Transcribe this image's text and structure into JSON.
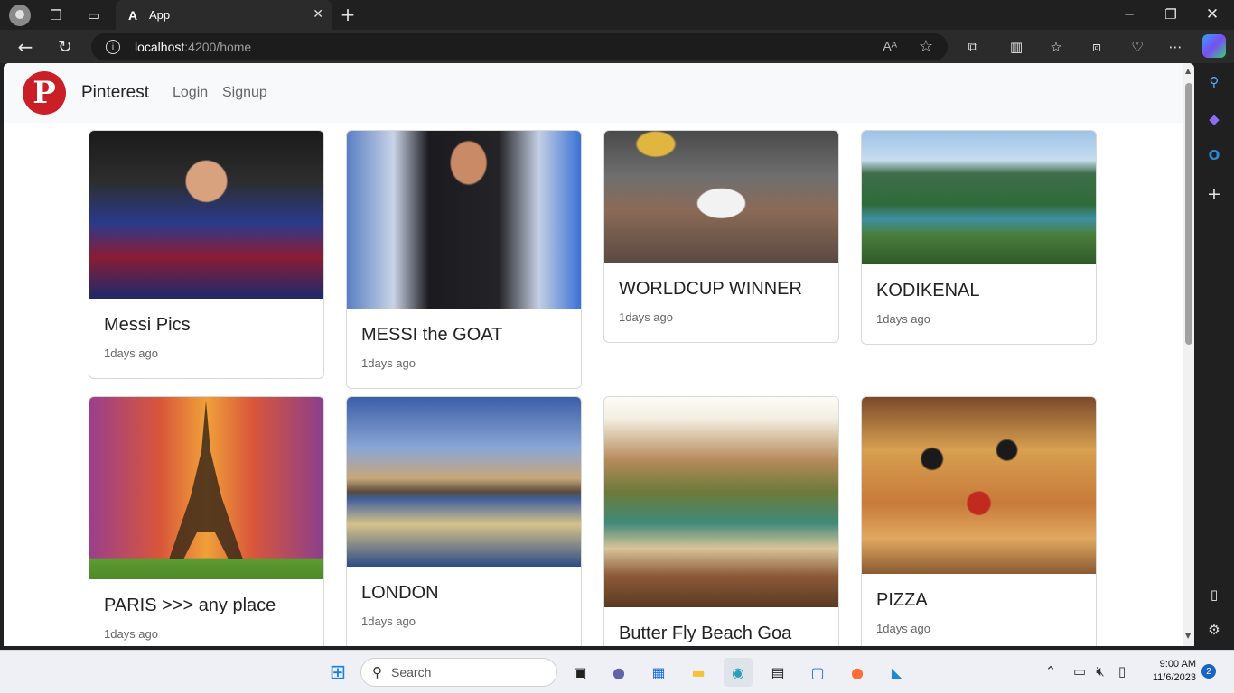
{
  "browser": {
    "tab_title": "App",
    "url_host": "localhost",
    "url_path": ":4200/home"
  },
  "app": {
    "brand": "Pinterest",
    "nav": [
      "Login",
      "Signup"
    ]
  },
  "cards": [
    {
      "title": "Messi Pics",
      "time": "1days ago",
      "image": "messi-barcelona-photo"
    },
    {
      "title": "MESSI the GOAT",
      "time": "1days ago",
      "image": "messi-inter-miami-photo"
    },
    {
      "title": "WORLDCUP WINNER",
      "time": "1days ago",
      "image": "worldcup-trophy-photo"
    },
    {
      "title": "KODIKENAL",
      "time": "1days ago",
      "image": "kodaikanal-lake-photo"
    },
    {
      "title": "PARIS >>> any place",
      "time": "1days ago",
      "image": "eiffel-tower-photo"
    },
    {
      "title": "LONDON",
      "time": "1days ago",
      "image": "london-parliament-photo"
    },
    {
      "title": "Butter Fly Beach Goa",
      "time": "",
      "image": "butterfly-beach-photo"
    },
    {
      "title": "PIZZA",
      "time": "1days ago",
      "image": "pizza-photo"
    }
  ],
  "taskbar": {
    "search_placeholder": "Search",
    "time": "9:00 AM",
    "date": "11/6/2023",
    "notification_count": "2"
  }
}
